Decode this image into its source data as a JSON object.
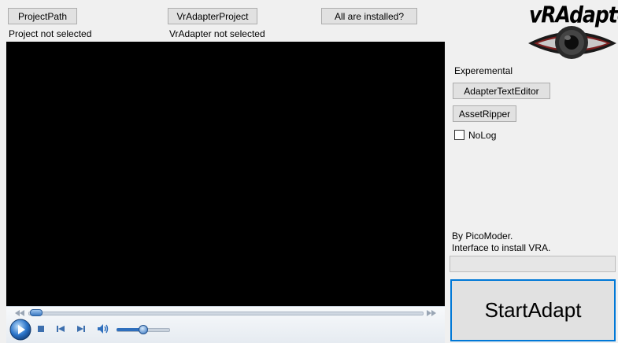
{
  "toolbar": {
    "project_path_label": "ProjectPath",
    "vradapter_project_label": "VrAdapterProject",
    "all_installed_label": "All are installed?"
  },
  "status": {
    "project": "Project not selected",
    "vradapter": "VrAdapter not selected"
  },
  "logo": {
    "text": "vRAdapter"
  },
  "side": {
    "experimental_label": "Experemental",
    "adapter_text_editor_label": "AdapterTextEditor",
    "asset_ripper_label": "AssetRipper",
    "nolog_label": "NoLog",
    "nolog_checked": false,
    "credit_line1": "By PicoModer.",
    "credit_line2": "Interface to install VRA.",
    "install_progress": 0,
    "start_label": "StartAdapt"
  },
  "media_player": {
    "seek_position": 0.02,
    "volume": 0.5,
    "icons": [
      "rewind-icon",
      "fast-forward-icon",
      "play-icon",
      "stop-icon",
      "previous-icon",
      "next-icon",
      "volume-icon"
    ]
  },
  "colors": {
    "window_bg": "#f0f0f0",
    "button_bg": "#e1e1e1",
    "focus_border": "#0078d7",
    "player_bg": "#000000"
  }
}
